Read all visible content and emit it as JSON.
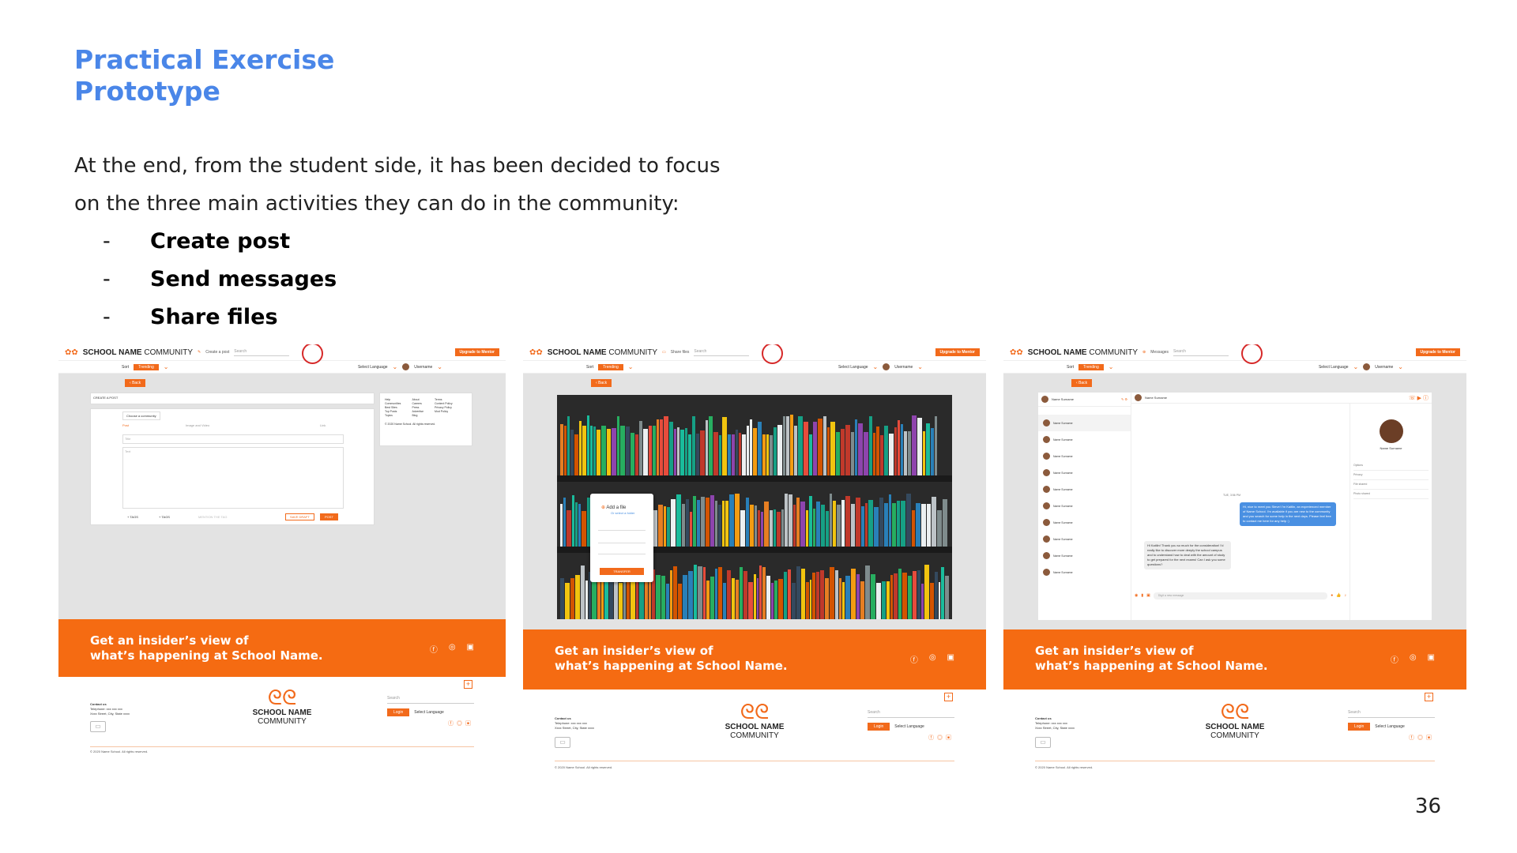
{
  "title_line1": "Practical Exercise",
  "title_line2": "Prototype",
  "intro_line1": "At the end, from the student side, it has been decided to focus",
  "intro_line2": "on the three main activities they can do in the community:",
  "bullets": [
    "Create post",
    "Send messages",
    "Share files"
  ],
  "page_number": "36",
  "mockup": {
    "brand_bold": "SCHOOL NAME",
    "brand_light": "COMMUNITY",
    "search": "Search",
    "upgrade": "Upgrade to Mentor",
    "sort": "Sort",
    "trending": "Trending",
    "select_language": "Select Language",
    "username": "Username",
    "back": "Back",
    "banner_line1": "Get an insider’s view of",
    "banner_line2": "what’s happening at School Name.",
    "footer_name1": "SCHOOL NAME",
    "footer_name2": "COMMUNITY",
    "contact_us": "Contact us",
    "telephone": "Telephone: xxx xxx xxx",
    "address": "Xxxx Street, City, State xxxx",
    "login": "Login",
    "copyright": "© 2020 Name School. All rights reserved.",
    "panel1_action": "Create a post",
    "panel2_action": "Share files",
    "panel3_action": "Messages"
  },
  "create_post": {
    "heading": "CREATE A POST",
    "choose_community": "Choose a community",
    "tab_post": "Post",
    "tab_image": "Image and Video",
    "tab_link": "Link",
    "title_placeholder": "Title",
    "text_placeholder": "Text",
    "tags1": "TAGS",
    "tags2": "TAGS",
    "mention": "MENTION THE TAG",
    "save_draft": "SAVE DRAFT",
    "post": "POST",
    "links_col1": [
      "Help",
      "Communities",
      "Best Sites",
      "Top Posts",
      "Topics"
    ],
    "links_col2": [
      "About",
      "Careers",
      "Press",
      "Advertise",
      "Blog"
    ],
    "links_col3": [
      "Terms",
      "Content Policy",
      "Privacy Policy",
      "Mod Policy"
    ],
    "side_copyright": "© 2020 Name School. All rights reserved."
  },
  "share_files": {
    "add_file": "Add a file",
    "select_folder": "Or select a folder",
    "transfer": "TRANSFER"
  },
  "messages": {
    "name_surname": "Name Surname",
    "contacts_count": 10,
    "time": "TUE, 3:56 PM",
    "msg_out": "Hi, nice to meet you Steve! I'm Kaitlin, an experienced member of Name School. I'm available if you are new to the community and you search for some help in the next days. Please feel free to contact me here for any help :)",
    "msg_in": "Hi Kaitlin! Thank you so much for the consideration! I'd really like to discover more deeply the school campus and to understand how to deal with the amount of study to get prepared for the next exams! Can I ask you some questions?",
    "input_placeholder": "Digit a new message",
    "options": [
      "Options",
      "Privacy",
      "File shared",
      "Photo shared"
    ]
  },
  "colors": {
    "accent": "#f26a1b",
    "title_blue": "#4a86e8",
    "circle_red": "#d62828"
  }
}
